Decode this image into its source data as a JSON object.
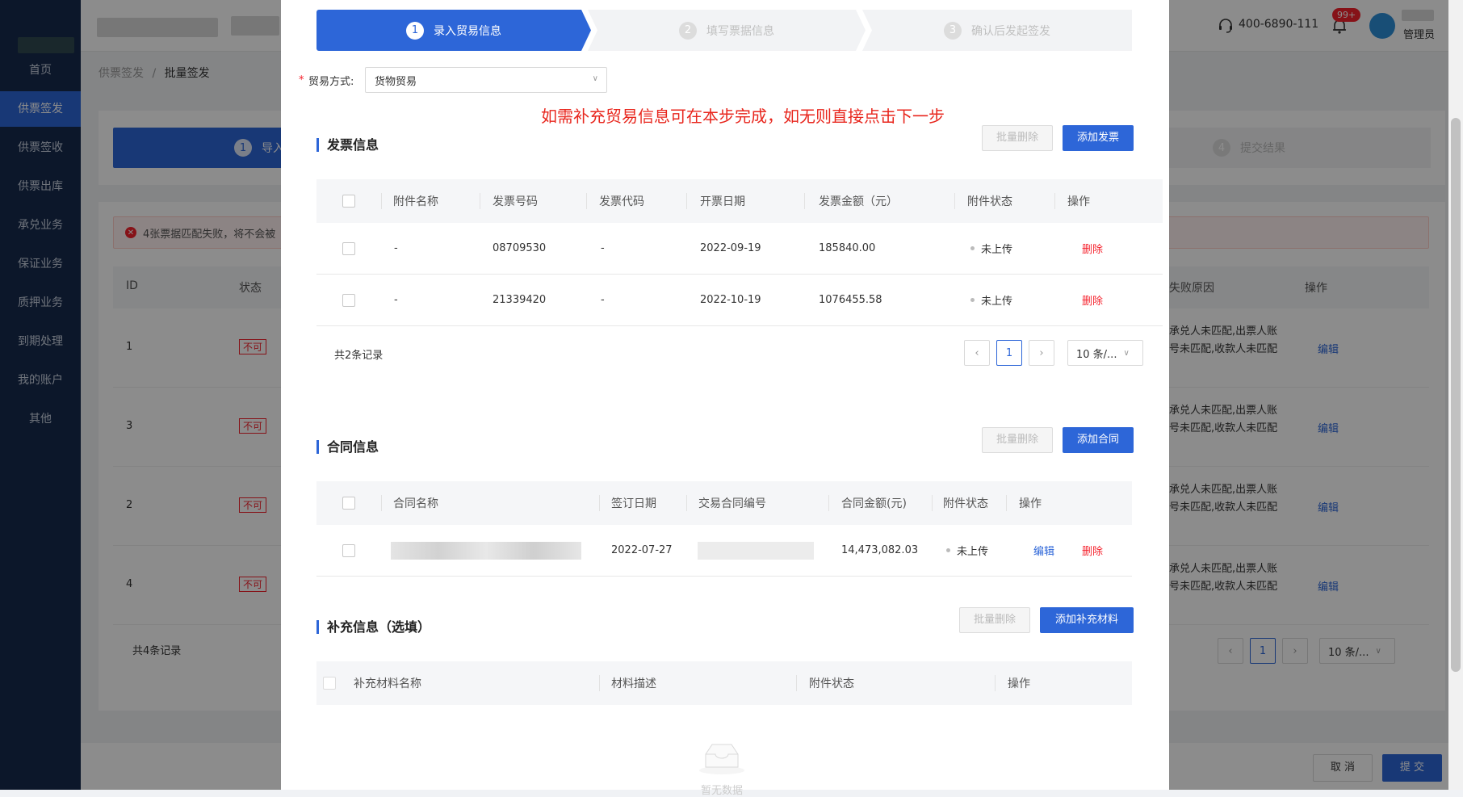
{
  "sidebar": {
    "items": [
      "首页",
      "供票签发",
      "供票签收",
      "供票出库",
      "承兑业务",
      "保证业务",
      "质押业务",
      "到期处理",
      "我的账户",
      "其他"
    ],
    "active_index": 1
  },
  "topbar": {
    "phone": "400-6890-111",
    "badge": "99+",
    "user_role": "管理员"
  },
  "breadcrumb": {
    "parent": "供票签发",
    "separator": "/",
    "current": "批量签发"
  },
  "bg_page": {
    "step_num": "1",
    "step_label": "导入",
    "step4_num": "4",
    "step4_label": "提交结果",
    "alert": "4张票据匹配失败，将不会被",
    "table_headers": [
      "ID",
      "状态",
      "失败原因",
      "操作"
    ],
    "rows": [
      {
        "id": "1",
        "status": "不可",
        "reason": "承兑人未匹配,出票人账号未匹配,收款人未匹配",
        "action": "编辑"
      },
      {
        "id": "3",
        "status": "不可",
        "reason": "承兑人未匹配,出票人账号未匹配,收款人未匹配",
        "action": "编辑"
      },
      {
        "id": "2",
        "status": "不可",
        "reason": "承兑人未匹配,出票人账号未匹配,收款人未匹配",
        "action": "编辑"
      },
      {
        "id": "4",
        "status": "不可",
        "reason": "承兑人未匹配,出票人账号未匹配,收款人未匹配",
        "action": "编辑"
      }
    ],
    "total": "共4条记录",
    "page": "1",
    "page_size": "10 条/...",
    "cancel": "取 消",
    "submit": "提 交"
  },
  "modal": {
    "steps": [
      {
        "num": "1",
        "label": "录入贸易信息",
        "active": true
      },
      {
        "num": "2",
        "label": "填写票据信息",
        "active": false
      },
      {
        "num": "3",
        "label": "确认后发起签发",
        "active": false
      }
    ],
    "trade_label": "贸易方式:",
    "trade_required": "*",
    "trade_value": "货物贸易",
    "hint": "如需补充贸易信息可在本步完成，如无则直接点击下一步",
    "invoice": {
      "title": "发票信息",
      "batch_delete": "批量删除",
      "add": "添加发票",
      "headers": [
        "附件名称",
        "发票号码",
        "发票代码",
        "开票日期",
        "发票金额（元）",
        "附件状态",
        "操作"
      ],
      "rows": [
        {
          "attach": "-",
          "number": "08709530",
          "code": "-",
          "date": "2022-09-19",
          "amount": "185840.00",
          "status": "未上传",
          "action": "删除"
        },
        {
          "attach": "-",
          "number": "21339420",
          "code": "-",
          "date": "2022-10-19",
          "amount": "1076455.58",
          "status": "未上传",
          "action": "删除"
        }
      ],
      "total": "共2条记录",
      "page": "1",
      "page_size": "10 条/..."
    },
    "contract": {
      "title": "合同信息",
      "batch_delete": "批量删除",
      "add": "添加合同",
      "headers": [
        "合同名称",
        "签订日期",
        "交易合同编号",
        "合同金额(元)",
        "附件状态",
        "操作"
      ],
      "rows": [
        {
          "date": "2022-07-27",
          "amount": "14,473,082.03",
          "status": "未上传",
          "edit": "编辑",
          "delete": "删除"
        }
      ]
    },
    "supplement": {
      "title": "补充信息（选填）",
      "batch_delete": "批量删除",
      "add": "添加补充材料",
      "headers": [
        "补充材料名称",
        "材料描述",
        "附件状态",
        "操作"
      ],
      "empty": "暂无数据"
    }
  }
}
